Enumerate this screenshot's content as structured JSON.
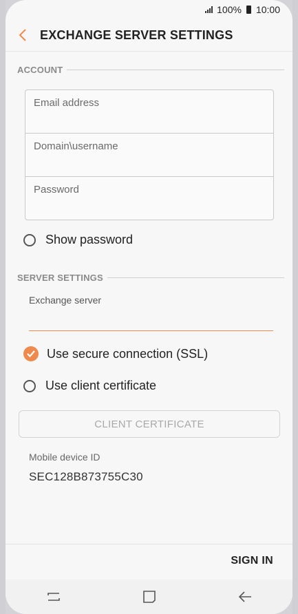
{
  "status_bar": {
    "signal": "signal-icon",
    "battery_percent": "100%",
    "battery": "battery-icon",
    "time": "10:00"
  },
  "app_bar": {
    "back_icon": "chevron-left-icon",
    "title": "EXCHANGE SERVER SETTINGS"
  },
  "account": {
    "header": "ACCOUNT",
    "fields": [
      {
        "label": "Email address",
        "value": ""
      },
      {
        "label": "Domain\\username",
        "value": ""
      },
      {
        "label": "Password",
        "value": ""
      }
    ],
    "show_password": {
      "label": "Show password",
      "checked": false
    }
  },
  "server_settings": {
    "header": "SERVER SETTINGS",
    "exchange_server": {
      "label": "Exchange server",
      "value": ""
    },
    "use_ssl": {
      "label": "Use secure connection (SSL)",
      "checked": true
    },
    "use_client_certificate": {
      "label": "Use client certificate",
      "checked": false
    },
    "client_certificate_button": "CLIENT CERTIFICATE",
    "mobile_device_id": {
      "label": "Mobile device ID",
      "value": "SEC128B873755C30"
    }
  },
  "footer": {
    "sign_in": "SIGN IN"
  },
  "nav_bar": {
    "recents": "recents-icon",
    "home": "home-icon",
    "back": "back-arrow-icon"
  },
  "colors": {
    "accent": "#ef8a4e",
    "background": "#f7f7f7"
  }
}
